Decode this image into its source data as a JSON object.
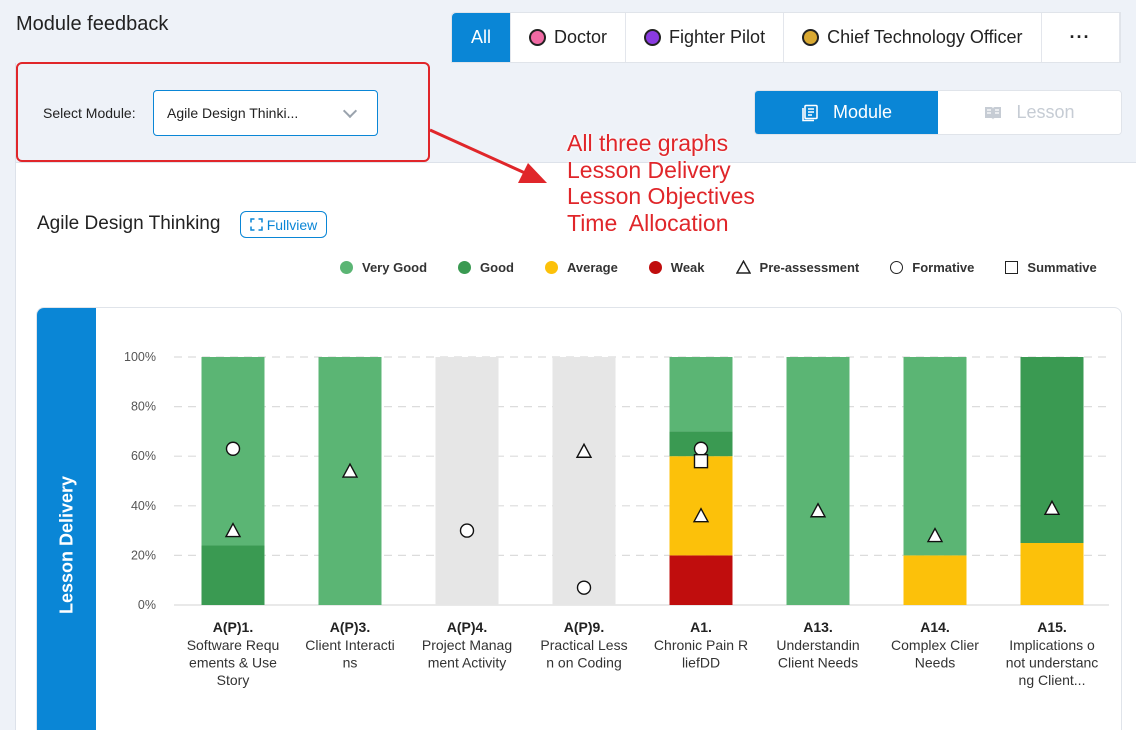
{
  "page": {
    "title": "Module feedback"
  },
  "role_tabs": [
    {
      "label": "All",
      "active": true
    },
    {
      "label": "Doctor",
      "color": "#f06aa4"
    },
    {
      "label": "Fighter Pilot",
      "color": "#8a3be0"
    },
    {
      "label": "Chief Technology Officer",
      "color": "#d9a933"
    }
  ],
  "more_label": "···",
  "select": {
    "label": "Select Module:",
    "value": "Agile Design Thinki..."
  },
  "view_toggle": {
    "module_label": "Module",
    "lesson_label": "Lesson"
  },
  "chart_header": {
    "title": "Agile Design Thinking",
    "fullview_label": "Fullview"
  },
  "legend": [
    {
      "label": "Very Good",
      "kind": "dot",
      "color": "#5bb574"
    },
    {
      "label": "Good",
      "kind": "dot",
      "color": "#3a9a52"
    },
    {
      "label": "Average",
      "kind": "dot",
      "color": "#fcc10a"
    },
    {
      "label": "Weak",
      "kind": "dot",
      "color": "#c00d0d"
    },
    {
      "label": "Pre-assessment",
      "kind": "triangle"
    },
    {
      "label": "Formative",
      "kind": "circle"
    },
    {
      "label": "Summative",
      "kind": "square"
    }
  ],
  "annotation": {
    "lines": [
      "All three graphs",
      "Lesson Delivery",
      "Lesson Objectives",
      "Time  Allocation"
    ]
  },
  "chart_data": {
    "type": "bar",
    "title": "Lesson Delivery",
    "ylim": [
      0,
      100
    ],
    "y_ticks": [
      "0%",
      "20%",
      "40%",
      "60%",
      "80%",
      "100%"
    ],
    "grid": true,
    "colors": {
      "very_good": "#5bb574",
      "good": "#3a9a52",
      "average": "#fcc10a",
      "weak": "#c00d0d",
      "no_data": "#e6e6e6"
    },
    "categories": [
      {
        "code": "A(P)1.",
        "lines": [
          "Software Requ",
          "ements & Use",
          "Story"
        ]
      },
      {
        "code": "A(P)3.",
        "lines": [
          "Client Interacti",
          "ns"
        ]
      },
      {
        "code": "A(P)4.",
        "lines": [
          "Project Manag",
          "ment Activity"
        ]
      },
      {
        "code": "A(P)9.",
        "lines": [
          "Practical Less",
          "n on Coding"
        ]
      },
      {
        "code": "A1.",
        "lines": [
          "Chronic Pain R",
          "liefDD"
        ]
      },
      {
        "code": "A13.",
        "lines": [
          "Understandin",
          "Client Needs"
        ]
      },
      {
        "code": "A14.",
        "lines": [
          "Complex Clier",
          "Needs"
        ]
      },
      {
        "code": "A15.",
        "lines": [
          "Implications o",
          "not understanc",
          "ng Client..."
        ]
      }
    ],
    "series": [
      {
        "name": "Weak",
        "key": "weak",
        "values": [
          0,
          0,
          0,
          0,
          20,
          0,
          0,
          0
        ]
      },
      {
        "name": "Average",
        "key": "average",
        "values": [
          0,
          0,
          0,
          0,
          40,
          0,
          20,
          25
        ]
      },
      {
        "name": "Good",
        "key": "good",
        "values": [
          24,
          0,
          0,
          0,
          10,
          0,
          0,
          75
        ]
      },
      {
        "name": "Very Good",
        "key": "very_good",
        "values": [
          76,
          100,
          0,
          0,
          30,
          100,
          80,
          0
        ]
      }
    ],
    "no_data": [
      false,
      false,
      true,
      true,
      false,
      false,
      false,
      false
    ],
    "markers": {
      "pre_assessment": [
        30,
        54,
        null,
        62,
        36,
        38,
        28,
        39
      ],
      "formative": [
        63,
        null,
        30,
        7,
        63,
        null,
        null,
        null
      ],
      "summative": [
        null,
        null,
        null,
        null,
        58,
        null,
        null,
        null
      ]
    }
  }
}
